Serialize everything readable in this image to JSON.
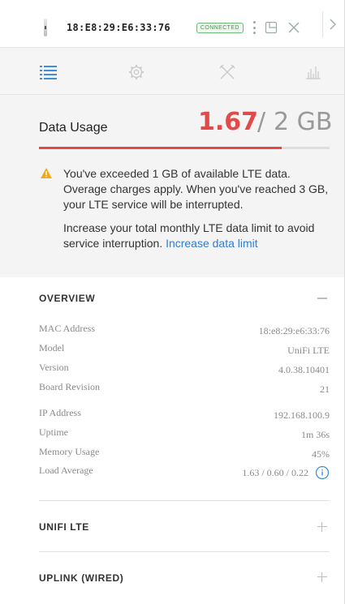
{
  "header": {
    "device_name": "18:E8:29:E6:33:76",
    "status": "CONNECTED"
  },
  "tabs": [
    {
      "name": "details",
      "icon": "list-icon",
      "active": true
    },
    {
      "name": "configuration",
      "icon": "gear-icon",
      "active": false
    },
    {
      "name": "tools",
      "icon": "tools-icon",
      "active": false
    },
    {
      "name": "statistics",
      "icon": "bar-chart-icon",
      "active": false
    }
  ],
  "data_usage": {
    "title": "Data Usage",
    "used": "1.67",
    "separator": "/",
    "total": "2 GB",
    "fraction_used": 0.835,
    "warning_text": "You've exceeded 1 GB of available LTE data. Overage charges apply. When you've reached 3 GB, your LTE service will be interrupted.",
    "advice_text": "Increase your total monthly LTE data limit to avoid service interruption.",
    "link_text": "Increase data limit"
  },
  "overview": {
    "title": "OVERVIEW",
    "rows": [
      {
        "label": "MAC Address",
        "value": "18:e8:29:e6:33:76"
      },
      {
        "label": "Model",
        "value": "UniFi LTE"
      },
      {
        "label": "Version",
        "value": "4.0.38.10401"
      },
      {
        "label": "Board Revision",
        "value": "21"
      },
      {
        "label": "IP Address",
        "value": "192.168.100.9"
      },
      {
        "label": "Uptime",
        "value": "1m 36s"
      },
      {
        "label": "Memory Usage",
        "value": "45%"
      },
      {
        "label": "Load Average",
        "value": "1.63 / 0.60 / 0.22"
      }
    ]
  },
  "sections": [
    {
      "title": "UNIFI LTE"
    },
    {
      "title": "UPLINK (WIRED)"
    }
  ],
  "colors": {
    "accent": "#2e7dd4",
    "danger": "#e24a4a",
    "success": "#3b9a43",
    "warning": "#f0a81e"
  }
}
